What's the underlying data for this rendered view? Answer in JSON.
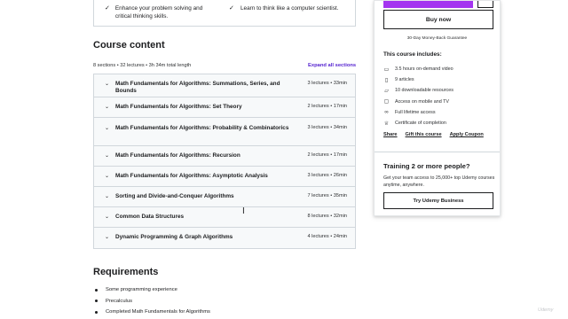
{
  "learn": {
    "items": [
      "Enhance your problem solving and critical thinking skills.",
      "Learn to think like a computer scientist."
    ]
  },
  "content": {
    "heading": "Course content",
    "meta": "8 sections • 32 lectures • 3h 34m total length",
    "expand_all": "Expand all sections",
    "sections": [
      {
        "title": "Math Fundamentals for Algorithms: Summations, Series, and Bounds",
        "count": "3 lectures • 33min"
      },
      {
        "title": "Math Fundamentals for Algorithms: Set Theory",
        "count": "2 lectures • 17min"
      },
      {
        "title": "Math Fundamentals for Algorithms: Probability & Combinatorics",
        "count": "3 lectures • 34min"
      },
      {
        "title": "Math Fundamentals for Algorithms: Recursion",
        "count": "2 lectures • 17min"
      },
      {
        "title": "Math Fundamentals for Algorithms: Asymptotic Analysis",
        "count": "3 lectures • 26min"
      },
      {
        "title": "Sorting and Divide-and-Conquer Algorithms",
        "count": "7 lectures • 35min"
      },
      {
        "title": "Common Data Structures",
        "count": "8 lectures • 32min"
      },
      {
        "title": "Dynamic Programming & Graph Algorithms",
        "count": "4 lectures • 24min"
      }
    ]
  },
  "requirements": {
    "heading": "Requirements",
    "items": [
      "Some programming experience",
      "Precalculus",
      "Completed Math Fundamentals for Algorithms"
    ]
  },
  "sidebar": {
    "buy_now": "Buy now",
    "guarantee": "30-Day Money-Back Guarantee",
    "includes_title": "This course includes:",
    "includes": [
      {
        "icon": "video-icon",
        "glyph": "▭",
        "text": "3.5 hours on-demand video"
      },
      {
        "icon": "file-icon",
        "glyph": "▯",
        "text": "9 articles"
      },
      {
        "icon": "folder-icon",
        "glyph": "▱",
        "text": "10 downloadable resources"
      },
      {
        "icon": "mobile-icon",
        "glyph": "▢",
        "text": "Access on mobile and TV"
      },
      {
        "icon": "infinity-icon",
        "glyph": "∞",
        "text": "Full lifetime access"
      },
      {
        "icon": "trophy-icon",
        "glyph": "♕",
        "text": "Certificate of completion"
      }
    ],
    "links": [
      "Share",
      "Gift this course",
      "Apply Coupon"
    ],
    "training_title": "Training 2 or more people?",
    "training_desc": "Get your team access to 25,000+ top Udemy courses anytime, anywhere.",
    "business_button": "Try Udemy Business"
  },
  "watermark": "Udemy",
  "colors": {
    "accent": "#5624d0",
    "purple": "#a435f0",
    "border": "#d1d7dc",
    "row_bg": "#f7f9fa"
  }
}
